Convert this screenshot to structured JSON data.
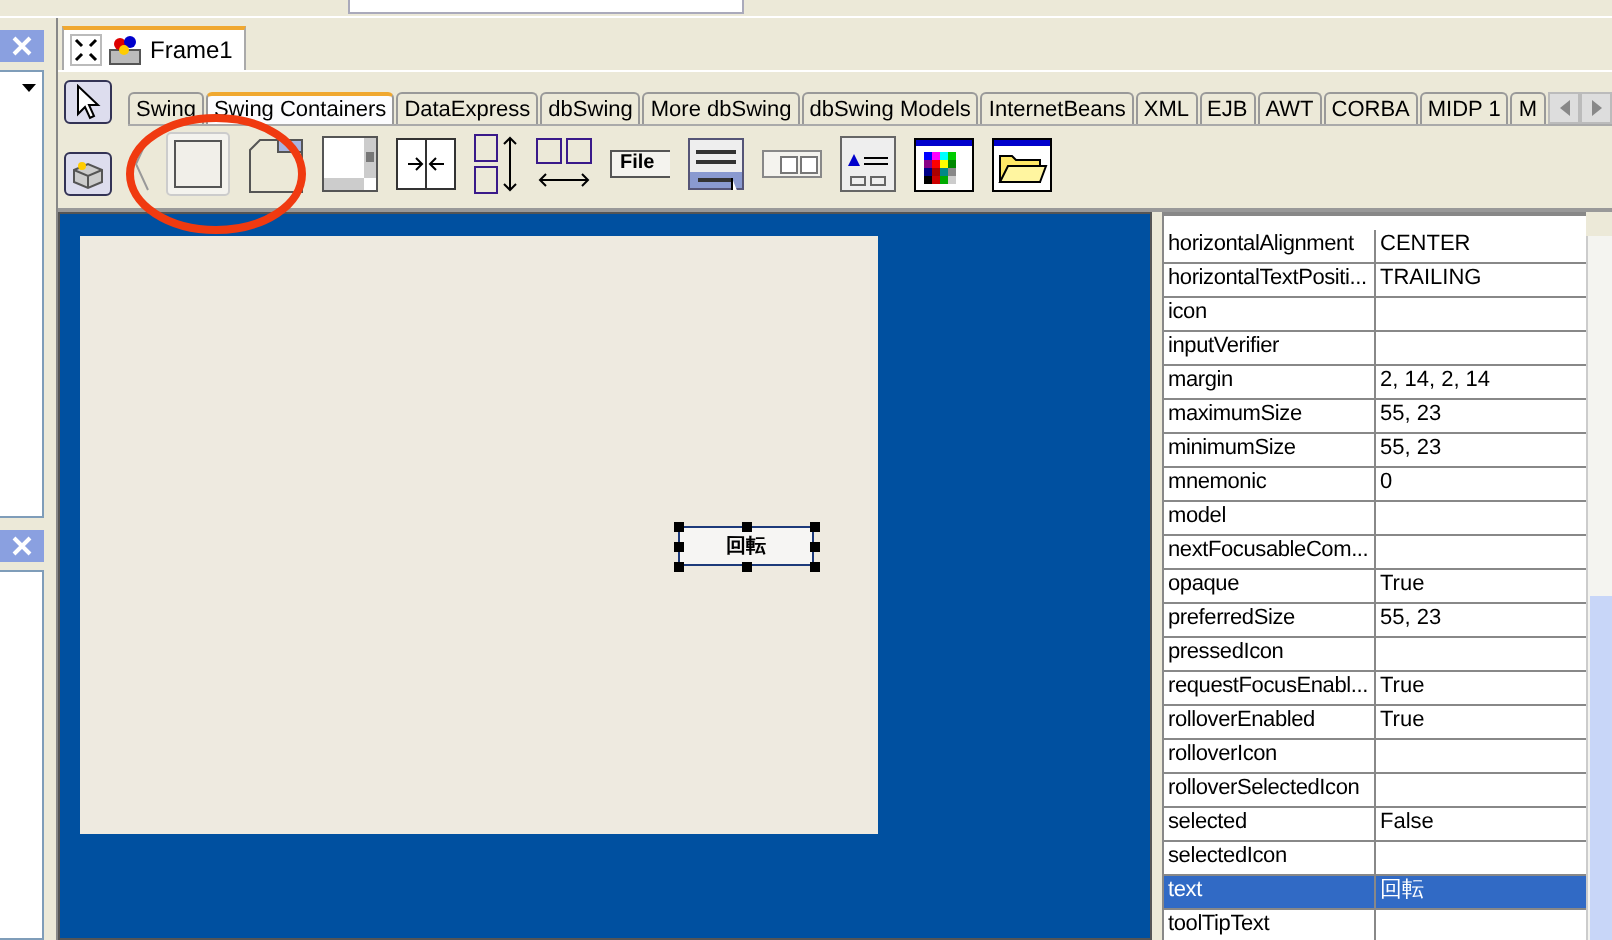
{
  "document_tabs": [
    {
      "label": "Frame1",
      "selected": true
    }
  ],
  "palette": {
    "tabs": [
      {
        "label": "Swing",
        "selected": false
      },
      {
        "label": "Swing Containers",
        "selected": true
      },
      {
        "label": "DataExpress",
        "selected": false
      },
      {
        "label": "dbSwing",
        "selected": false
      },
      {
        "label": "More dbSwing",
        "selected": false
      },
      {
        "label": "dbSwing Models",
        "selected": false
      },
      {
        "label": "InternetBeans",
        "selected": false
      },
      {
        "label": "XML",
        "selected": false
      },
      {
        "label": "EJB",
        "selected": false
      },
      {
        "label": "AWT",
        "selected": false
      },
      {
        "label": "CORBA",
        "selected": false
      },
      {
        "label": "MIDP 1",
        "selected": false
      },
      {
        "label": "M",
        "selected": false
      }
    ],
    "items": [
      {
        "kind": "file",
        "label": "File"
      }
    ]
  },
  "designer": {
    "button": {
      "text": "回転",
      "selected": true
    }
  },
  "properties": {
    "rows": [
      {
        "name": "horizontalAlignment",
        "value": "CENTER",
        "selected": false
      },
      {
        "name": "horizontalTextPositi...",
        "value": "TRAILING",
        "selected": false
      },
      {
        "name": "icon",
        "value": "",
        "selected": false
      },
      {
        "name": "inputVerifier",
        "value": "",
        "selected": false
      },
      {
        "name": "margin",
        "value": "2, 14, 2, 14",
        "selected": false
      },
      {
        "name": "maximumSize",
        "value": "55, 23",
        "selected": false
      },
      {
        "name": "minimumSize",
        "value": "55, 23",
        "selected": false
      },
      {
        "name": "mnemonic",
        "value": "0",
        "selected": false
      },
      {
        "name": "model",
        "value": "",
        "selected": false
      },
      {
        "name": "nextFocusableCom...",
        "value": "",
        "selected": false
      },
      {
        "name": "opaque",
        "value": "True",
        "selected": false
      },
      {
        "name": "preferredSize",
        "value": "55, 23",
        "selected": false
      },
      {
        "name": "pressedIcon",
        "value": "",
        "selected": false
      },
      {
        "name": "requestFocusEnabl...",
        "value": "True",
        "selected": false
      },
      {
        "name": "rolloverEnabled",
        "value": "True",
        "selected": false
      },
      {
        "name": "rolloverIcon",
        "value": "",
        "selected": false
      },
      {
        "name": "rolloverSelectedIcon",
        "value": "",
        "selected": false
      },
      {
        "name": "selected",
        "value": "False",
        "selected": false
      },
      {
        "name": "selectedIcon",
        "value": "",
        "selected": false
      },
      {
        "name": "text",
        "value": "回転",
        "selected": true
      },
      {
        "name": "toolTipText",
        "value": "",
        "selected": false
      }
    ]
  }
}
